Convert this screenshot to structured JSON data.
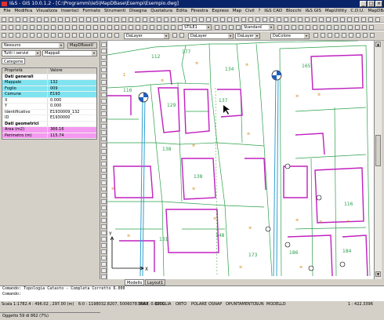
{
  "window": {
    "title": "I&S - GIS 10.0.1.2 - [C:\\Programmi\\IeS\\MapDBase\\Esempi\\Esempio.dwg]",
    "buttons": [
      "_",
      "□",
      "×"
    ]
  },
  "menu": [
    "File",
    "Modifica",
    "Visualizza",
    "Inserisci",
    "Formato",
    "Strumenti",
    "Disegna",
    "Quotatura",
    "Edita",
    "Finestra",
    "Express",
    "Map",
    "Civil",
    "?",
    "I&S CAD",
    "Blocchi",
    "I&S GIS",
    "MapUtility",
    "C.D.U.",
    "MapDBase",
    "Immagini"
  ],
  "toolbar": {
    "style_combo": "STILE1",
    "dim_combo": "Standard",
    "layer_combo1": "DaLayer",
    "layer_combo2": "DaLayer",
    "layer_combo3": "DaLayer",
    "color_combo": "DaColore"
  },
  "panel": {
    "db_combo": "Nessuno",
    "db_button": "MapDBaseV",
    "filter_combo": "Tutti i servizi",
    "map_combo": "Mappali",
    "tab": "Categorie",
    "col_property": "Proprietà",
    "col_value": "Valore",
    "rows": [
      {
        "label": "Dati generali",
        "value": "",
        "kind": "group"
      },
      {
        "label": "Mappale",
        "value": "132",
        "kind": "cyan"
      },
      {
        "label": "Foglio",
        "value": "009",
        "kind": "cyan"
      },
      {
        "label": "Comune",
        "value": "E193",
        "kind": "cyan"
      },
      {
        "label": "X",
        "value": "0.000",
        "kind": "plain"
      },
      {
        "label": "Y",
        "value": "0.000",
        "kind": "plain"
      },
      {
        "label": "Identificativo",
        "value": "E1930009_132",
        "kind": "plain"
      },
      {
        "label": "ID",
        "value": "E1930000",
        "kind": "plain"
      },
      {
        "label": "Dati geometrici",
        "value": "",
        "kind": "group"
      },
      {
        "label": "Area (m2)",
        "value": "366.16",
        "kind": "mag"
      },
      {
        "label": "Perimetro (m)",
        "value": "115.74",
        "kind": "mag"
      }
    ],
    "footer": "Oggetto 59 di 862 (7%)"
  },
  "drawing": {
    "parcels": [
      "112",
      "177",
      "134",
      "165",
      "116",
      "129",
      "137",
      "138",
      "138",
      "131",
      "148",
      "173",
      "186",
      "184",
      "116"
    ],
    "tabs": [
      "Modello",
      "Layout1"
    ]
  },
  "command": {
    "line1": "Comando:  Topologia Catasto - Completa Corretto 6.000",
    "line2": "Comando:"
  },
  "status": {
    "coords": "Scala 1:1782.4 : 496.02 , 297.00 (m)",
    "coords2": "6:0 : 1198032.8207, 5006078.3063, 0.0000",
    "modes": [
      "SNAP",
      "GRIGLIA",
      "ORTO",
      "POLARE",
      "OSNAP",
      "OPUNTAMENTO",
      "SUN",
      "MODELLO"
    ],
    "scale": "1 : 422.3396"
  },
  "colors": {
    "parcel_green": "#2aa04a",
    "building_magenta": "#c020c0",
    "road_cyan": "#30a0d0",
    "label_orange": "#d08000",
    "titlebar": "#0a246a"
  }
}
